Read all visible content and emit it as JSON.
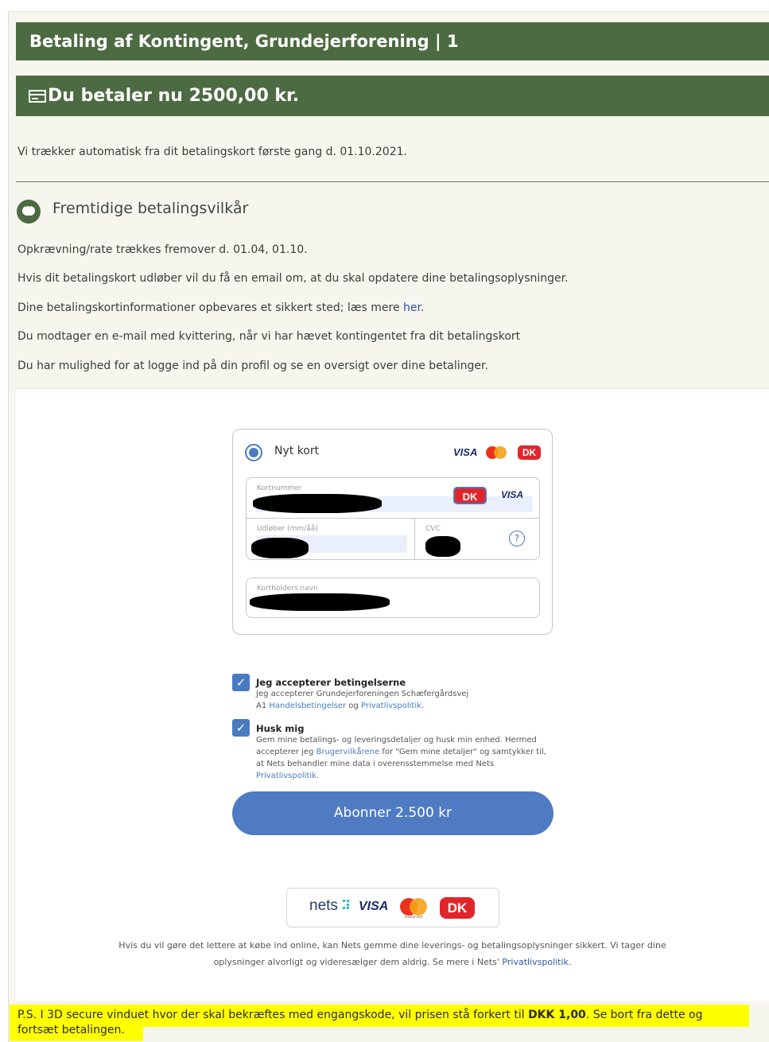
{
  "header": {
    "title": "Betaling af Kontingent, Grundejerforening | 1",
    "amount_title": "Du betaler nu 2500,00  kr."
  },
  "intro": {
    "auto_charge": "Vi trækker automatisk fra dit betalingskort første gang d. 01.10.2021."
  },
  "terms": {
    "title": "Fremtidige betalingsvilkår",
    "rate_line": "Opkrævning/rate trækkes fremover d.   01.04, 01.10.",
    "expiry_line": "Hvis dit betalingskort udløber vil du få en email om, at du skal opdatere dine betalingsoplysninger.",
    "storage_prefix": "Dine betalingskortinformationer opbevares et sikkert sted; læs mere ",
    "storage_link": "her",
    "storage_suffix": ".",
    "receipt_line": "Du modtager en e-mail med kvittering, når vi har hævet kontingentet fra dit betalingskort",
    "profile_line": "Du har mulighed for at logge ind på din profil og se en oversigt over dine betalinger."
  },
  "payment": {
    "new_card_label": "Nyt kort",
    "visa": "VISA",
    "card_number_label": "Kortnummer",
    "expiry_label": "Udløber (mm/åå)",
    "cvc_label": "CVC",
    "help_icon_glyph": "?",
    "cardholder_label": "Kortholders navn",
    "accept_title": "Jeg accepterer betingelserne",
    "accept_text_1": "Jeg accepterer Grundejerforeningen Schæfergårdsvej",
    "accept_text_2_prefix": "A1 ",
    "accept_link_1": "Handelsbetingelser",
    "accept_and": " og ",
    "accept_link_2": "Privatlivspolitik",
    "accept_end": ".",
    "remember_title": "Husk mig",
    "remember_text_1": "Gem mine betalings- og leveringsdetaljer og husk min enhed. Hermed",
    "remember_text_2_prefix": "accepterer jeg ",
    "remember_link_1": "Brugervilkårene",
    "remember_text_2_suffix": " for  \"Gem mine detaljer\" og samtykker til,",
    "remember_text_3": "at Nets behandler mine data i overensstemmelse med Nets",
    "remember_link_2": "Privatlivspolitik",
    "remember_end": ".",
    "subscribe_button": "Abonner 2.500 kr",
    "nets_logo": "nets",
    "dk_logo": "DK",
    "mastercard_caption": "mastercard",
    "footer_1": "Hvis du vil gøre det lettere at købe ind online, kan Nets gemme dine leverings- og betalingsoplysninger sikkert. Vi tager dine",
    "footer_2_prefix": "oplysninger alvorligt og videresælger dem aldrig. Se mere i Nets' ",
    "footer_link": "Privatlivspolitik",
    "footer_end": "."
  },
  "ps": {
    "line1_prefix": "P.S. I 3D secure vinduet hvor der skal bekræftes med engangskode, vil prisen stå forkert til ",
    "line1_bold": "DKK 1,00",
    "line1_suffix": ". Se bort fra dette og",
    "line2": "fortsæt betalingen."
  },
  "colors": {
    "header_green": "#4d6b42",
    "button_blue": "#4e7bc2",
    "highlight_yellow": "#ffff00"
  },
  "icons": [
    "credit-card-icon",
    "chat-bubble-icon",
    "help-icon",
    "checkmark-icon"
  ]
}
